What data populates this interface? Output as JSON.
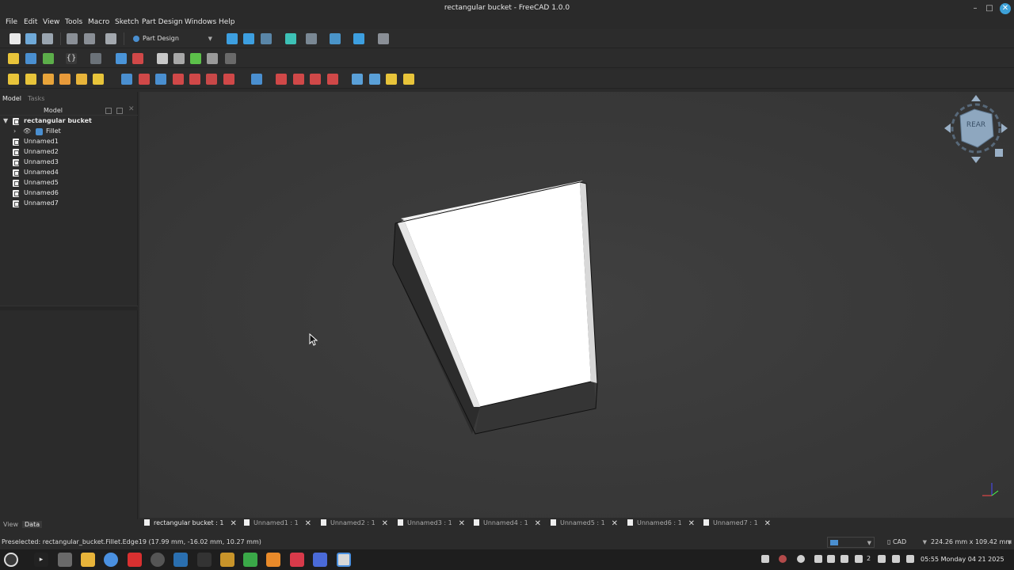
{
  "window": {
    "title": "rectangular bucket - FreeCAD 1.0.0"
  },
  "menu": [
    "File",
    "Edit",
    "View",
    "Tools",
    "Macro",
    "Sketch",
    "Part Design",
    "Windows",
    "Help"
  ],
  "workbench": {
    "selected": "Part Design"
  },
  "panel": {
    "tabs": [
      "Model",
      "Tasks"
    ],
    "tree_header": "Model",
    "tree": {
      "root": "rectangular bucket",
      "feature": "Fillet",
      "docs": [
        "Unnamed1",
        "Unnamed2",
        "Unnamed3",
        "Unnamed4",
        "Unnamed5",
        "Unnamed6",
        "Unnamed7"
      ]
    },
    "bottom_tabs": [
      "View",
      "Data"
    ]
  },
  "navcube": {
    "face": "REAR"
  },
  "doc_tabs": [
    "rectangular bucket : 1",
    "Unnamed1 : 1",
    "Unnamed2 : 1",
    "Unnamed3 : 1",
    "Unnamed4 : 1",
    "Unnamed5 : 1",
    "Unnamed6 : 1",
    "Unnamed7 : 1"
  ],
  "status": {
    "message": "Preselected: rectangular_bucket.Fillet.Edge19 (17.99 mm, -16.02 mm, 10.27 mm)",
    "nav_style": "CAD",
    "dimensions": "224.26 mm x 109.42 mm"
  },
  "taskbar": {
    "workspace": "2",
    "clock": "05:55 Monday 04 21 2025"
  },
  "colors": {
    "viewport_bg": "#3a3a3a",
    "accent": "#3da1d8",
    "solid_top": "#ffffff",
    "solid_side": "#303030"
  }
}
